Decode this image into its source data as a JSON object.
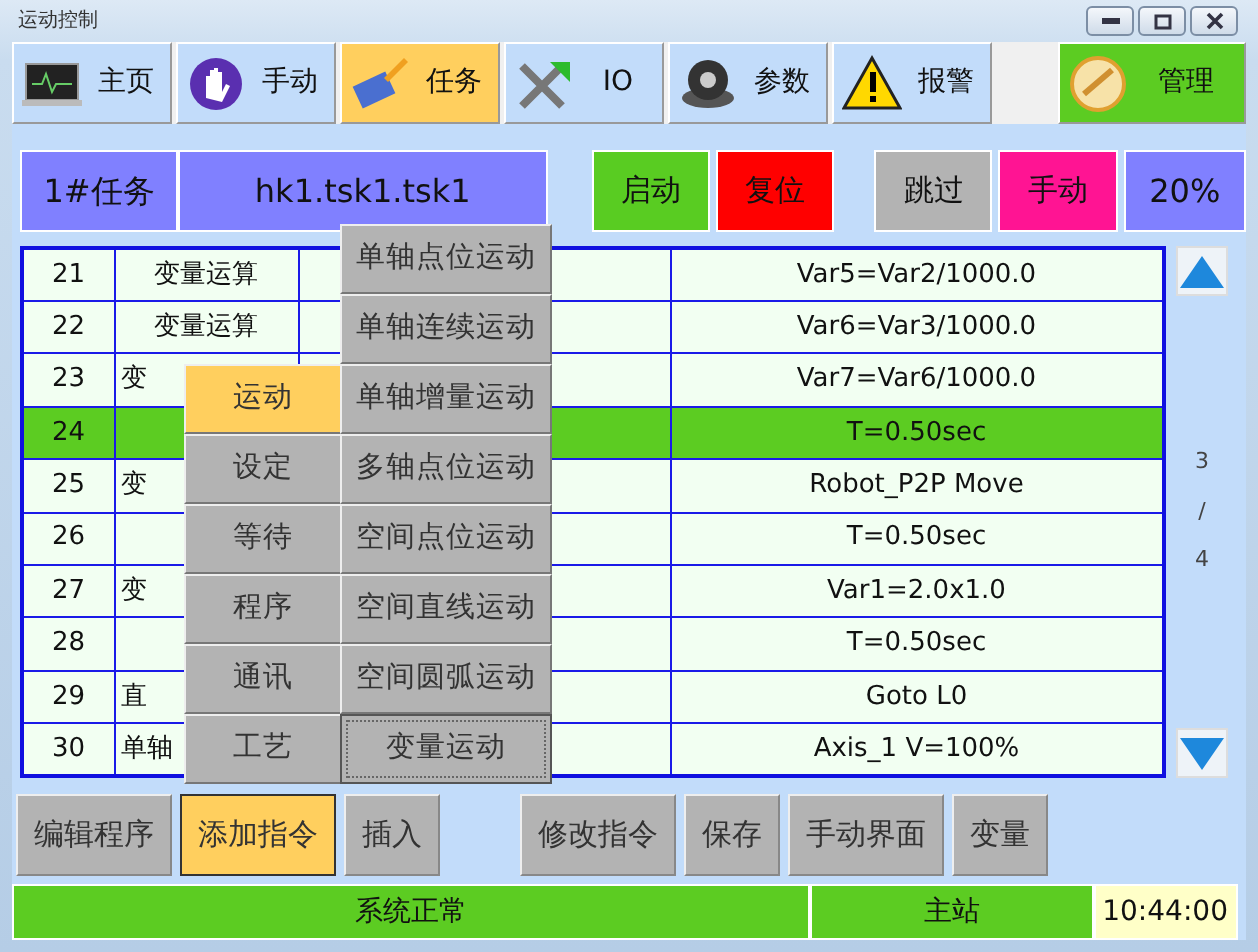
{
  "window": {
    "title": "运动控制"
  },
  "tabs": [
    {
      "label": "主页",
      "selected": false,
      "kind": "normal"
    },
    {
      "label": "手动",
      "selected": false,
      "kind": "normal"
    },
    {
      "label": "任务",
      "selected": true,
      "kind": "normal"
    },
    {
      "label": "IO",
      "selected": false,
      "kind": "normal"
    },
    {
      "label": "参数",
      "selected": false,
      "kind": "normal"
    },
    {
      "label": "报警",
      "selected": false,
      "kind": "normal"
    },
    {
      "label": "管理",
      "selected": false,
      "kind": "admin"
    }
  ],
  "task_bar": {
    "task": "1#任务",
    "program": "hk1.tsk1.tsk1",
    "percent": "20%",
    "buttons": [
      {
        "label": "启动",
        "color": "#59cc22"
      },
      {
        "label": "复位",
        "color": "#ff0000"
      },
      {
        "label": "跳过",
        "color": "#b3b3b3"
      },
      {
        "label": "手动",
        "color": "#ff1493"
      }
    ]
  },
  "table": {
    "rows": [
      {
        "no": "21",
        "type": "变量运算",
        "param": "Var5=Var2/1000.0",
        "selected": false
      },
      {
        "no": "22",
        "type": "变量运算",
        "param": "Var6=Var3/1000.0",
        "selected": false
      },
      {
        "no": "23",
        "type": "变",
        "param": "Var7=Var6/1000.0",
        "selected": false
      },
      {
        "no": "24",
        "param": "T=0.50sec",
        "selected": true
      },
      {
        "no": "25",
        "type": "变",
        "param": "Robot_P2P Move",
        "selected": false
      },
      {
        "no": "26",
        "param": "T=0.50sec",
        "selected": false
      },
      {
        "no": "27",
        "type": "变",
        "param": "Var1=2.0x1.0",
        "selected": false
      },
      {
        "no": "28",
        "param": "T=0.50sec",
        "selected": false
      },
      {
        "no": "29",
        "type": "直",
        "param": "Goto L0",
        "selected": false
      },
      {
        "no": "30",
        "type": "单轴",
        "param": "Axis_1 V=100%",
        "selected": false
      }
    ]
  },
  "pager": {
    "current": "3",
    "separator": "/",
    "total": "4"
  },
  "menu": {
    "items": [
      {
        "label": "运动",
        "selected": true
      },
      {
        "label": "设定",
        "selected": false
      },
      {
        "label": "等待",
        "selected": false
      },
      {
        "label": "程序",
        "selected": false
      },
      {
        "label": "通讯",
        "selected": false
      },
      {
        "label": "工艺",
        "selected": false
      }
    ]
  },
  "submenu": {
    "items": [
      {
        "label": "单轴点位运动",
        "focused": false
      },
      {
        "label": "单轴连续运动",
        "focused": false
      },
      {
        "label": "单轴增量运动",
        "focused": false
      },
      {
        "label": "多轴点位运动",
        "focused": false
      },
      {
        "label": "空间点位运动",
        "focused": false
      },
      {
        "label": "空间直线运动",
        "focused": false
      },
      {
        "label": "空间圆弧运动",
        "focused": false
      },
      {
        "label": "变量运动",
        "focused": true
      }
    ]
  },
  "bottom_buttons": [
    {
      "label": "编辑程序",
      "selected": false
    },
    {
      "label": "添加指令",
      "selected": true
    },
    {
      "label": "插入",
      "selected": false
    },
    {
      "label": "修改指令",
      "selected": false
    },
    {
      "label": "保存",
      "selected": false
    },
    {
      "label": "手动界面",
      "selected": false
    },
    {
      "label": "变量",
      "selected": false
    }
  ],
  "status_bar": {
    "message": "系统正常",
    "station": "主站",
    "time": "10:44:00"
  }
}
